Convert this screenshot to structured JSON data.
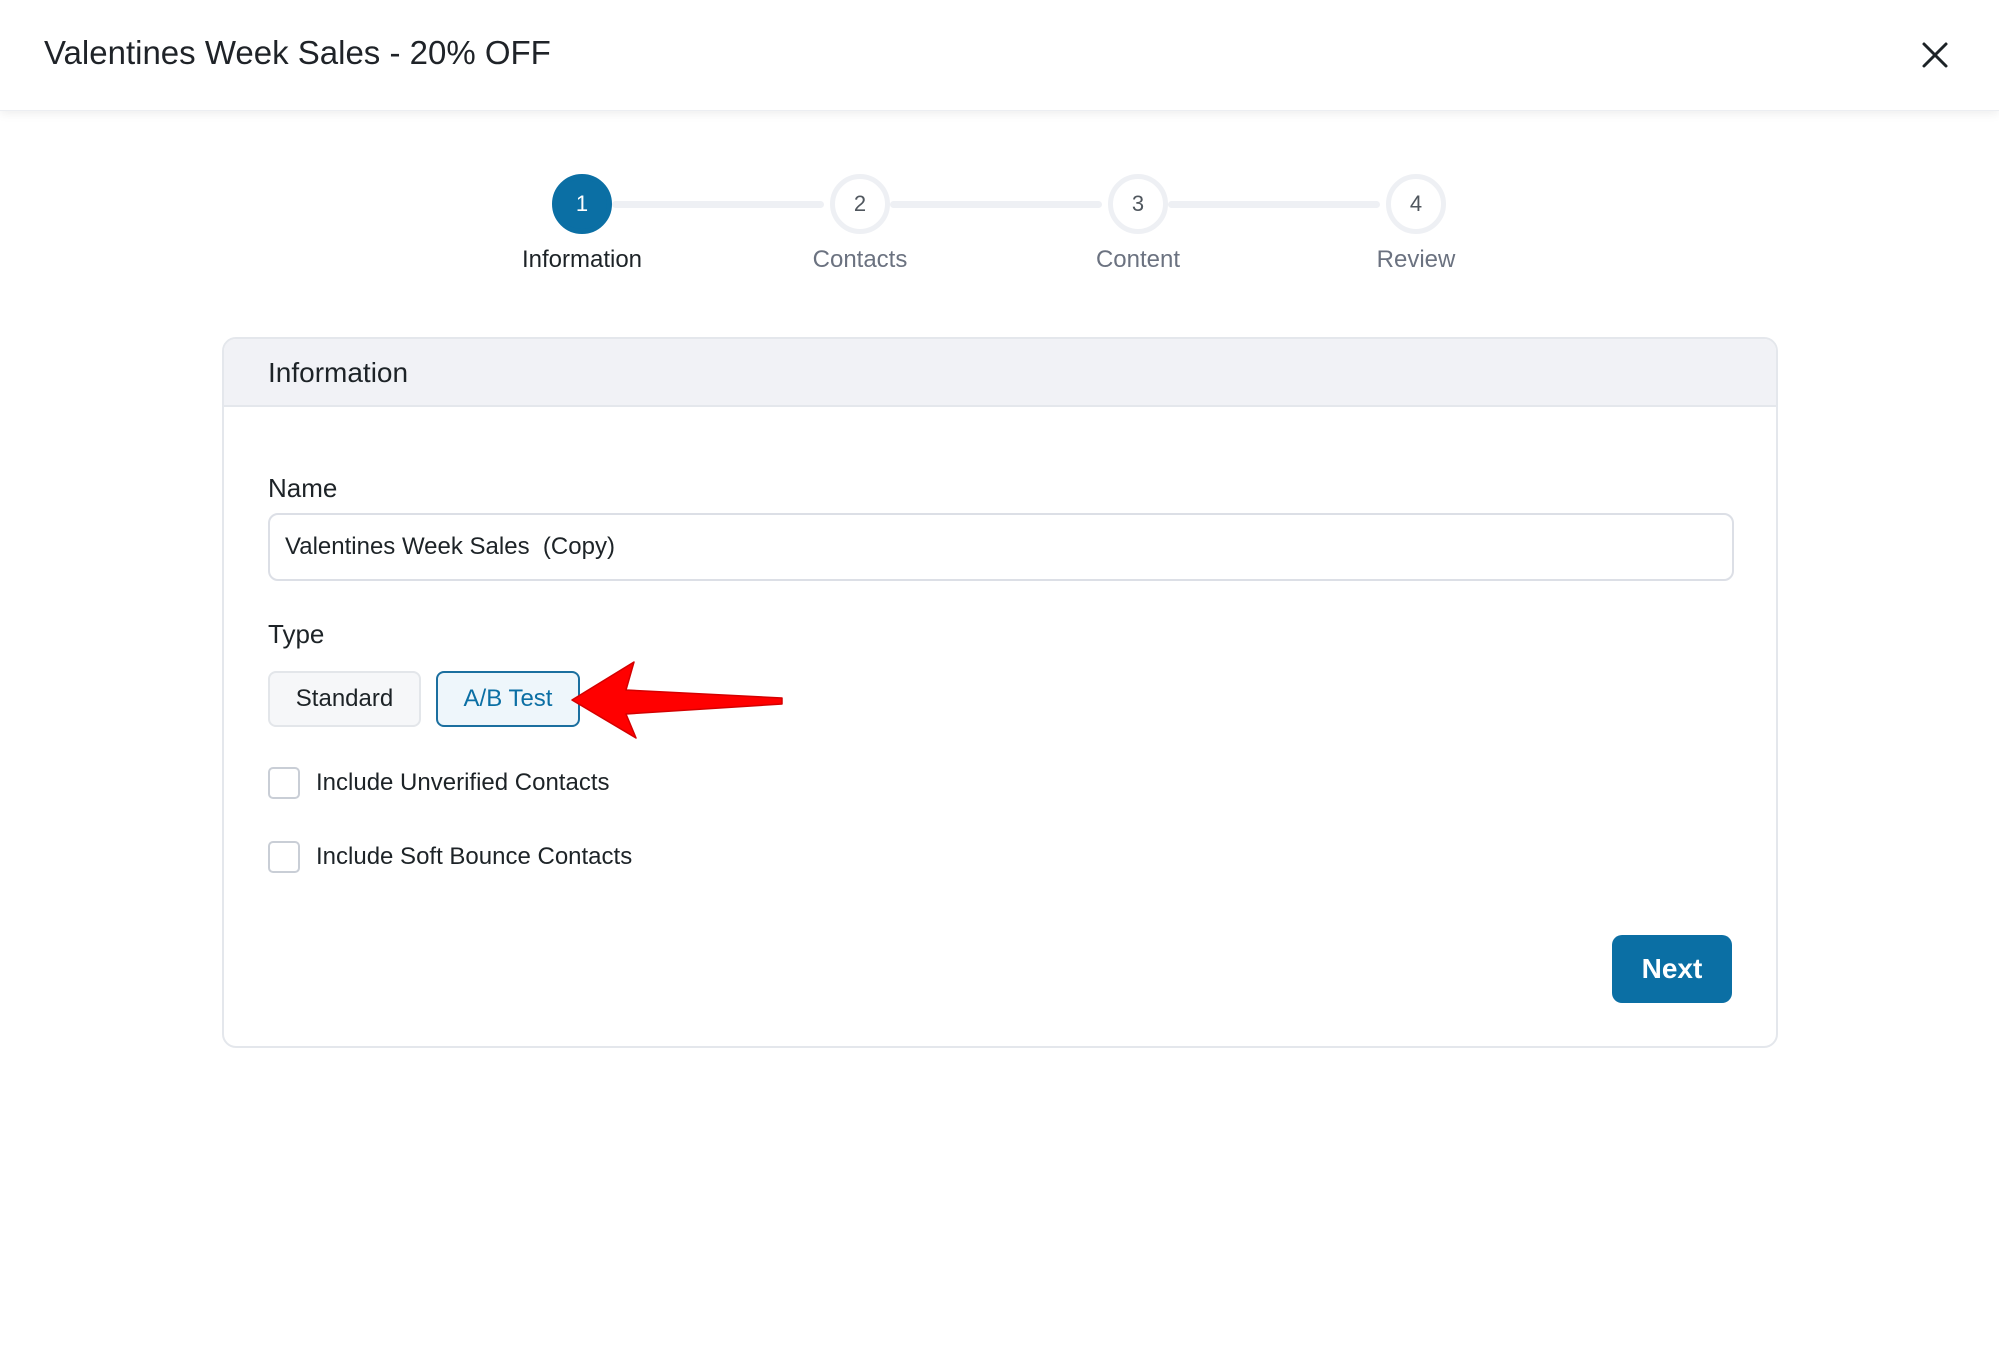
{
  "header": {
    "title": "Valentines Week Sales - 20% OFF",
    "close_icon": "close-icon"
  },
  "stepper": {
    "steps": [
      {
        "number": "1",
        "label": "Information",
        "active": true
      },
      {
        "number": "2",
        "label": "Contacts",
        "active": false
      },
      {
        "number": "3",
        "label": "Content",
        "active": false
      },
      {
        "number": "4",
        "label": "Review",
        "active": false
      }
    ]
  },
  "card": {
    "header": "Information",
    "name_label": "Name",
    "name_value": "Valentines Week Sales  (Copy)",
    "type_label": "Type",
    "type_options": [
      "Standard",
      "A/B Test"
    ],
    "type_selected": "A/B Test",
    "checkboxes": [
      {
        "label": "Include Unverified Contacts",
        "checked": false
      },
      {
        "label": "Include Soft Bounce Contacts",
        "checked": false
      }
    ],
    "next_label": "Next"
  },
  "annotation": {
    "arrow_icon": "red-arrow-icon"
  },
  "colors": {
    "accent": "#0b6fa4",
    "arrow": "#ff0000"
  }
}
